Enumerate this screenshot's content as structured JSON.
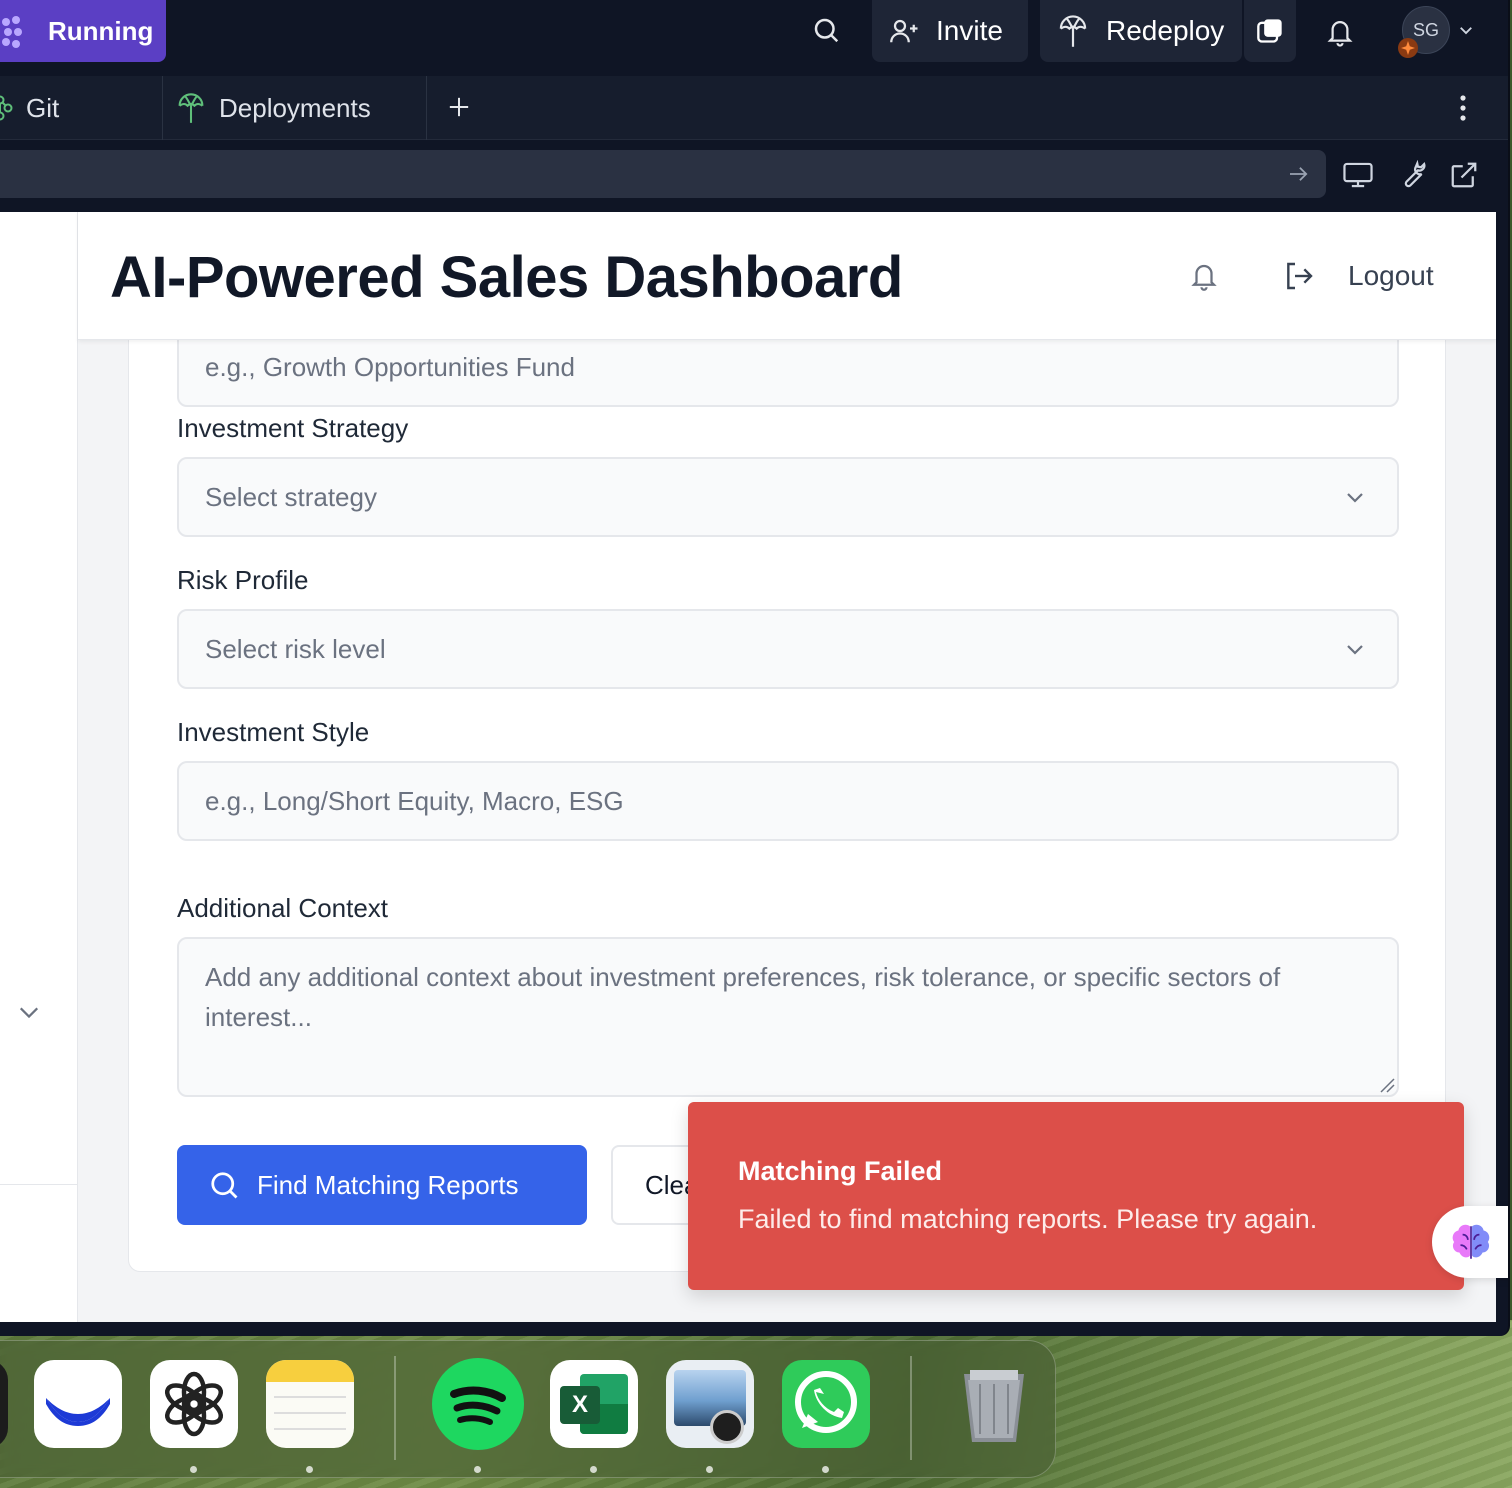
{
  "topbar": {
    "status_label": "Running",
    "invite_label": "Invite",
    "redeploy_label": "Redeploy",
    "avatar_initials": "SG"
  },
  "tabs": [
    {
      "label": "Git"
    },
    {
      "label": "Deployments"
    }
  ],
  "header": {
    "title": "AI-Powered Sales Dashboard",
    "logout_label": "Logout"
  },
  "form": {
    "fund_name_placeholder": "e.g., Growth Opportunities Fund",
    "strategy_label": "Investment Strategy",
    "strategy_placeholder": "Select strategy",
    "risk_label": "Risk Profile",
    "risk_placeholder": "Select risk level",
    "style_label": "Investment Style",
    "style_placeholder": "e.g., Long/Short Equity, Macro, ESG",
    "context_label": "Additional Context",
    "context_placeholder": "Add any additional context about investment preferences, risk tolerance, or specific sectors of interest...",
    "find_button": "Find Matching Reports",
    "clear_button": "Clear"
  },
  "toast": {
    "title": "Matching Failed",
    "description": "Failed to find matching reports. Please try again.",
    "color": "#dc4f49"
  },
  "dock": {
    "apps": [
      "Cursor",
      "ChatGPT",
      "Notes",
      "Spotify",
      "Microsoft Excel",
      "Preview",
      "WhatsApp",
      "Trash"
    ],
    "excel_glyph": "X"
  },
  "colors": {
    "accent": "#3563e9",
    "running_badge": "#5b3fc4",
    "topbar_bg": "#0f1525"
  }
}
